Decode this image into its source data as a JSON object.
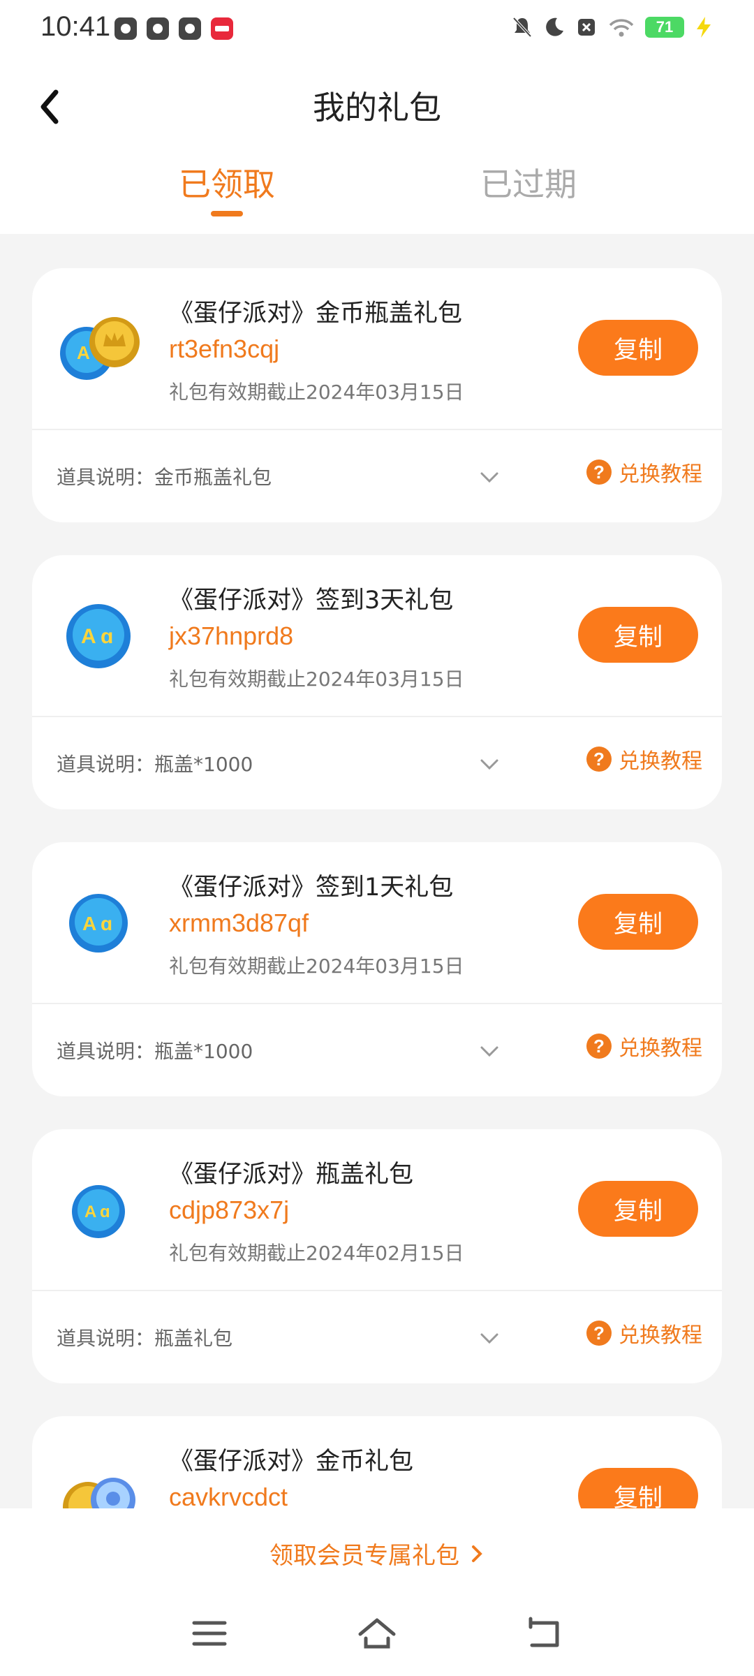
{
  "status_bar": {
    "time": "10:41",
    "battery": "71",
    "app_icons": [
      "tiktok-icon",
      "video-icon",
      "leaf-icon",
      "xiaohongshu-icon"
    ],
    "system_icons": [
      "mute-icon",
      "moon-icon",
      "close-box-icon",
      "wifi-icon",
      "battery-icon",
      "charging-icon"
    ]
  },
  "header": {
    "title": "我的礼包",
    "tabs": [
      {
        "label": "已领取",
        "active": true
      },
      {
        "label": "已过期",
        "active": false
      }
    ]
  },
  "gifts": [
    {
      "name": "《蛋仔派对》金币瓶盖礼包",
      "code": "rt3efn3cqj",
      "expiry": "礼包有效期截止2024年03月15日",
      "description": "道具说明：金币瓶盖礼包",
      "copy_label": "复制",
      "tutorial_label": "兑换教程",
      "icon": "coin-bottlecap-icon"
    },
    {
      "name": "《蛋仔派对》签到3天礼包",
      "code": "jx37hnprd8",
      "expiry": "礼包有效期截止2024年03月15日",
      "description": "道具说明：瓶盖*1000",
      "copy_label": "复制",
      "tutorial_label": "兑换教程",
      "icon": "bottlecap-icon"
    },
    {
      "name": "《蛋仔派对》签到1天礼包",
      "code": "xrmm3d87qf",
      "expiry": "礼包有效期截止2024年03月15日",
      "description": "道具说明：瓶盖*1000",
      "copy_label": "复制",
      "tutorial_label": "兑换教程",
      "icon": "bottlecap-icon"
    },
    {
      "name": "《蛋仔派对》瓶盖礼包",
      "code": "cdjp873x7j",
      "expiry": "礼包有效期截止2024年02月15日",
      "description": "道具说明：瓶盖礼包",
      "copy_label": "复制",
      "tutorial_label": "兑换教程",
      "icon": "bottlecap-icon"
    },
    {
      "name": "《蛋仔派对》金币礼包",
      "code": "cavkrvcdct",
      "copy_label": "复制",
      "icon": "coin-icon"
    }
  ],
  "footer": {
    "member_link": "领取会员专属礼包"
  },
  "colors": {
    "accent": "#f07a1d",
    "button": "#fb7a1b",
    "background": "#f4f4f4"
  }
}
